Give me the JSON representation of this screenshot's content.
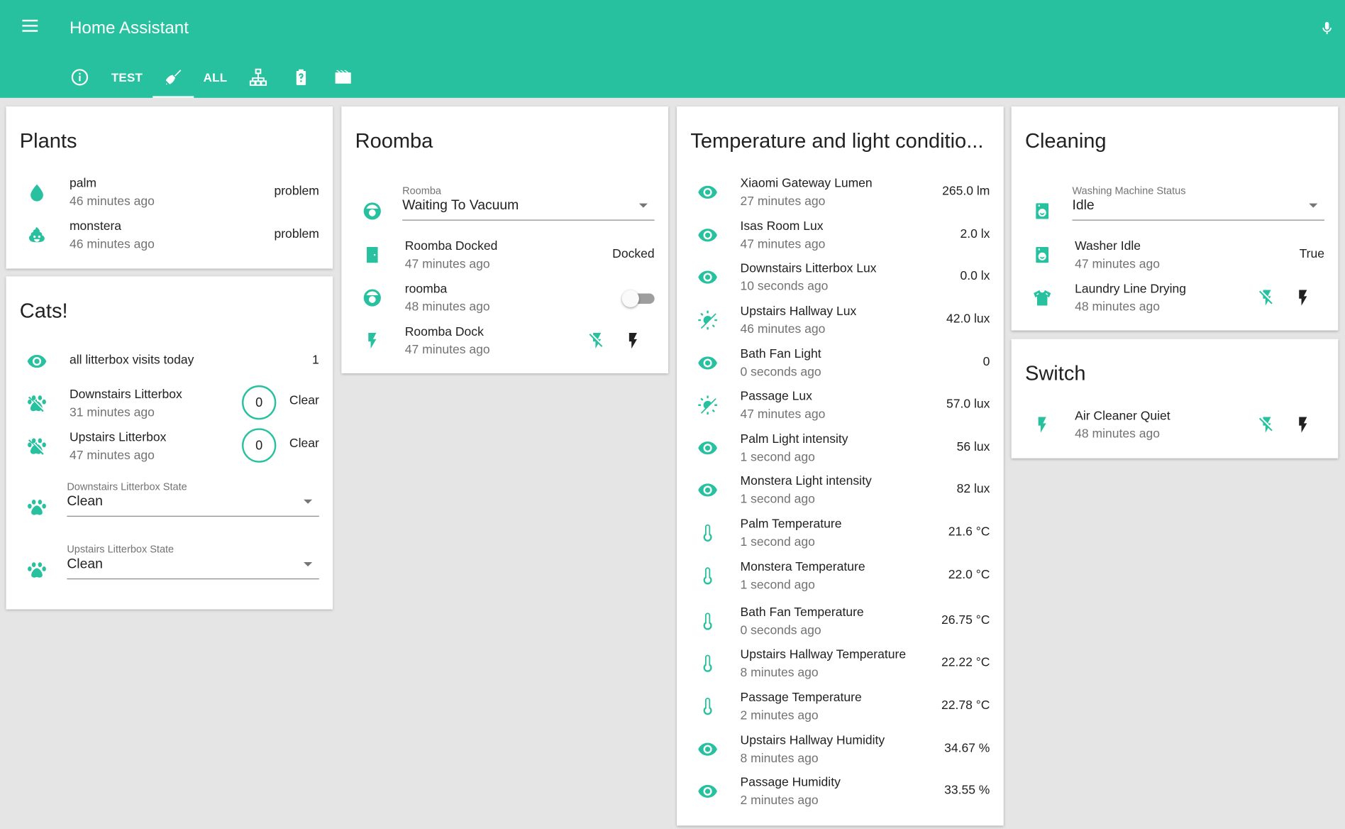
{
  "app": {
    "title": "Home Assistant"
  },
  "colors": {
    "accent": "#27c19f",
    "background": "#e5e5e5"
  },
  "tabs": [
    {
      "icon": "info-icon",
      "active": false
    },
    {
      "label": "TEST",
      "active": false
    },
    {
      "icon": "broom-icon",
      "active": true
    },
    {
      "label": "ALL",
      "active": false
    },
    {
      "icon": "network-icon",
      "active": false
    },
    {
      "icon": "battery-unknown-icon",
      "active": false
    },
    {
      "icon": "movie-icon",
      "active": false
    }
  ],
  "plants": {
    "title": "Plants",
    "rows": [
      {
        "icon": "water-drop-icon",
        "name": "palm",
        "time": "46 minutes ago",
        "value": "problem"
      },
      {
        "icon": "emoticon-poop-icon",
        "name": "monstera",
        "time": "46 minutes ago",
        "value": "problem"
      }
    ]
  },
  "cats": {
    "title": "Cats!",
    "visits": {
      "icon": "eye-icon",
      "name": "all litterbox visits today",
      "value": "1"
    },
    "counters": [
      {
        "icon": "paw-off-icon",
        "name": "Downstairs Litterbox",
        "time": "31 minutes ago",
        "count": "0",
        "action": "Clear"
      },
      {
        "icon": "paw-off-icon",
        "name": "Upstairs Litterbox",
        "time": "47 minutes ago",
        "count": "0",
        "action": "Clear"
      }
    ],
    "selects": [
      {
        "icon": "paw-icon",
        "label": "Downstairs Litterbox State",
        "value": "Clean"
      },
      {
        "icon": "paw-icon",
        "label": "Upstairs Litterbox State",
        "value": "Clean"
      }
    ]
  },
  "roomba": {
    "title": "Roomba",
    "select": {
      "icon": "robot-vacuum-icon",
      "label": "Roomba",
      "value": "Waiting To Vacuum"
    },
    "docked": {
      "icon": "door-icon",
      "name": "Roomba Docked",
      "time": "47 minutes ago",
      "value": "Docked"
    },
    "toggle": {
      "icon": "robot-vacuum-icon",
      "name": "roomba",
      "time": "48 minutes ago",
      "state": "off"
    },
    "dock": {
      "icon": "flash-icon",
      "name": "Roomba Dock",
      "time": "47 minutes ago"
    }
  },
  "sensors": {
    "title": "Temperature and light conditio...",
    "rows": [
      {
        "icon": "eye-icon",
        "name": "Xiaomi Gateway Lumen",
        "time": "27 minutes ago",
        "value": "265.0 lm"
      },
      {
        "icon": "eye-icon",
        "name": "Isas Room Lux",
        "time": "47 minutes ago",
        "value": "2.0 lx"
      },
      {
        "icon": "eye-icon",
        "name": "Downstairs Litterbox Lux",
        "time": "10 seconds ago",
        "value": "0.0 lx"
      },
      {
        "icon": "weather-sunny-icon",
        "name": "Upstairs Hallway Lux",
        "time": "46 minutes ago",
        "value": "42.0 lux"
      },
      {
        "icon": "eye-icon",
        "name": "Bath Fan Light",
        "time": "0 seconds ago",
        "value": "0"
      },
      {
        "icon": "weather-sunny-icon",
        "name": "Passage Lux",
        "time": "47 minutes ago",
        "value": "57.0 lux"
      },
      {
        "icon": "eye-icon",
        "name": "Palm Light intensity",
        "time": "1 second ago",
        "value": "56 lux"
      },
      {
        "icon": "eye-icon",
        "name": "Monstera Light intensity",
        "time": "1 second ago",
        "value": "82 lux"
      },
      {
        "icon": "thermometer-icon",
        "name": "Palm Temperature",
        "time": "1 second ago",
        "value": "21.6 °C"
      },
      {
        "icon": "thermometer-icon",
        "name": "Monstera Temperature",
        "time": "1 second ago",
        "value": "22.0 °C"
      },
      {
        "icon": "thermometer-icon",
        "name": "Bath Fan Temperature",
        "time": "0 seconds ago",
        "value": "26.75 °C"
      },
      {
        "icon": "thermometer-icon",
        "name": "Upstairs Hallway Temperature",
        "time": "8 minutes ago",
        "value": "22.22 °C"
      },
      {
        "icon": "thermometer-icon",
        "name": "Passage Temperature",
        "time": "2 minutes ago",
        "value": "22.78 °C"
      },
      {
        "icon": "eye-icon",
        "name": "Upstairs Hallway Humidity",
        "time": "8 minutes ago",
        "value": "34.67 %"
      },
      {
        "icon": "eye-icon",
        "name": "Passage Humidity",
        "time": "2 minutes ago",
        "value": "33.55 %"
      }
    ]
  },
  "cleaning": {
    "title": "Cleaning",
    "select": {
      "icon": "washing-machine-icon",
      "label": "Washing Machine Status",
      "value": "Idle"
    },
    "washer": {
      "icon": "washing-machine-icon",
      "name": "Washer Idle",
      "time": "47 minutes ago",
      "value": "True"
    },
    "laundry": {
      "icon": "tshirt-icon",
      "name": "Laundry Line Drying",
      "time": "48 minutes ago"
    }
  },
  "switch": {
    "title": "Switch",
    "row": {
      "icon": "flash-icon",
      "name": "Air Cleaner Quiet",
      "time": "48 minutes ago"
    }
  }
}
